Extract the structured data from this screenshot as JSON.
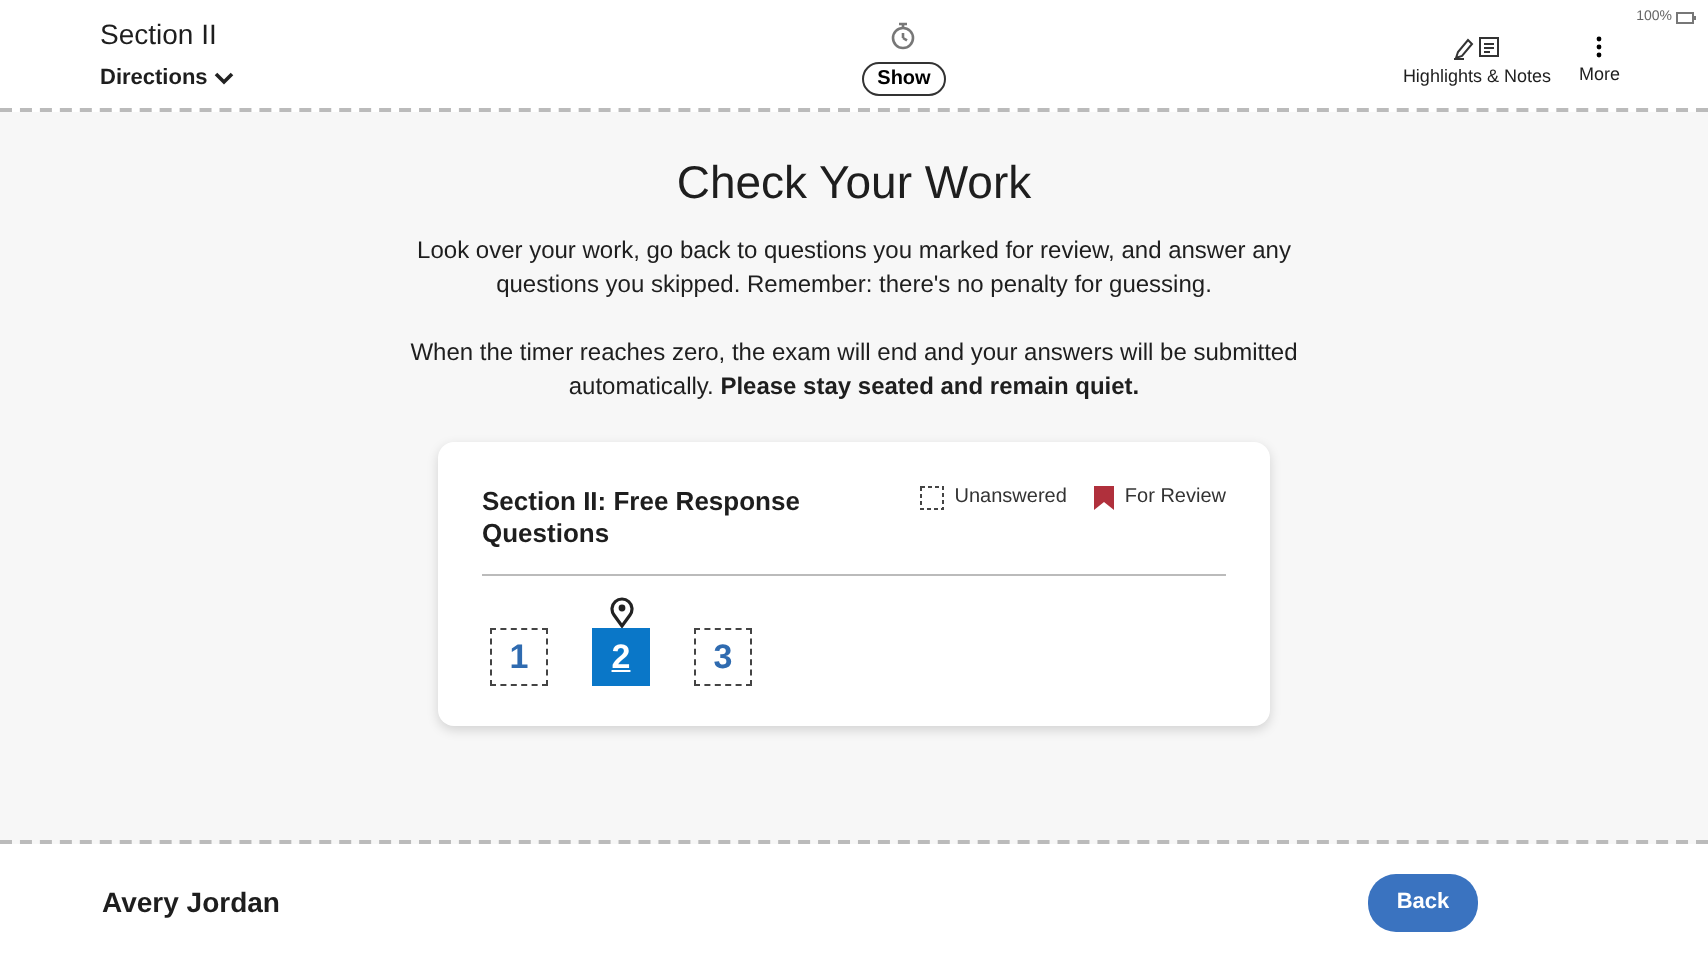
{
  "header": {
    "section": "Section II",
    "directions": "Directions",
    "timer_button": "Show",
    "battery": "100%",
    "tools": [
      {
        "label": "Highlights & Notes",
        "kind": "highlights"
      },
      {
        "label": "More",
        "kind": "more"
      }
    ]
  },
  "main": {
    "title": "Check Your Work",
    "paragraphs": [
      "Look over your work, go back to questions you marked for review, and answer any questions you skipped. Remember: there's no penalty for guessing.",
      "When the timer reaches zero, the exam will end and your answers will be submitted automatically. **Please stay seated and remain quiet.**"
    ],
    "card": {
      "title": "Section II: Free Response Questions",
      "legend": [
        {
          "label": "Unanswered",
          "kind": "unanswered"
        },
        {
          "label": "For Review",
          "kind": "review"
        }
      ],
      "questions": [
        {
          "number": "1",
          "selected": false,
          "answered": false
        },
        {
          "number": "2",
          "selected": true,
          "answered": false
        },
        {
          "number": "3",
          "selected": false,
          "answered": false
        }
      ]
    }
  },
  "footer": {
    "name": "Avery Jordan",
    "back_button": "Back"
  }
}
